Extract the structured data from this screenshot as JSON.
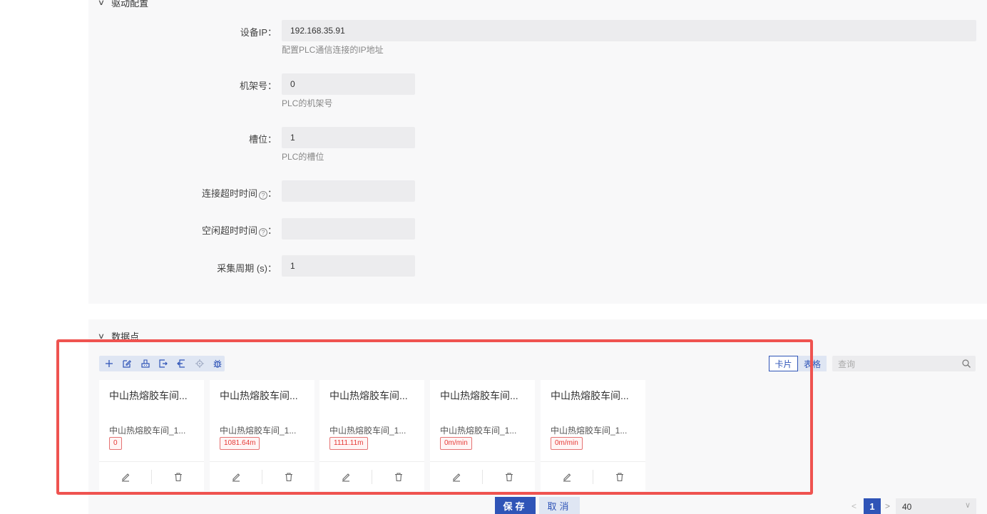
{
  "driver_section": {
    "title": "驱动配置",
    "fields": [
      {
        "label": "设备IP：",
        "value": "192.168.35.91",
        "hint": "配置PLC通信连接的IP地址"
      },
      {
        "label": "机架号：",
        "value": "0",
        "hint": "PLC的机架号"
      },
      {
        "label": "槽位：",
        "value": "1",
        "hint": "PLC的槽位"
      },
      {
        "label": "连接超时时间",
        "value": "",
        "hint": ""
      },
      {
        "label": "空闲超时时间",
        "value": "",
        "hint": ""
      },
      {
        "label": "采集周期 (s)：",
        "value": "1",
        "hint": ""
      }
    ],
    "colon": "："
  },
  "data_section": {
    "title": "数据点",
    "toolbar_icons": [
      "plus-icon",
      "edit-icon",
      "import-icon",
      "export-icon",
      "export-all-icon",
      "locate-icon",
      "debug-icon"
    ],
    "view_toggle": {
      "card": "卡片",
      "table": "表格",
      "active": "card"
    },
    "search_placeholder": "查询"
  },
  "cards": [
    {
      "title": "中山热熔胶车间...",
      "subtitle": "中山热熔胶车间_1...",
      "value": "0"
    },
    {
      "title": "中山热熔胶车间...",
      "subtitle": "中山热熔胶车间_1...",
      "value": "1081.64m"
    },
    {
      "title": "中山热熔胶车间...",
      "subtitle": "中山热熔胶车间_1...",
      "value": "1111.11m"
    },
    {
      "title": "中山热熔胶车间...",
      "subtitle": "中山热熔胶车间_1...",
      "value": "0m/min"
    },
    {
      "title": "中山热熔胶车间...",
      "subtitle": "中山热熔胶车间_1...",
      "value": "0m/min"
    }
  ],
  "footer": {
    "save_label": "保存",
    "cancel_label": "取消"
  },
  "pagination": {
    "current_page": "1",
    "page_size": "40",
    "prev": "<",
    "next": ">"
  },
  "colors": {
    "primary": "#2f54b7",
    "tag_red": "#e53935",
    "highlight": "#ef5350"
  }
}
